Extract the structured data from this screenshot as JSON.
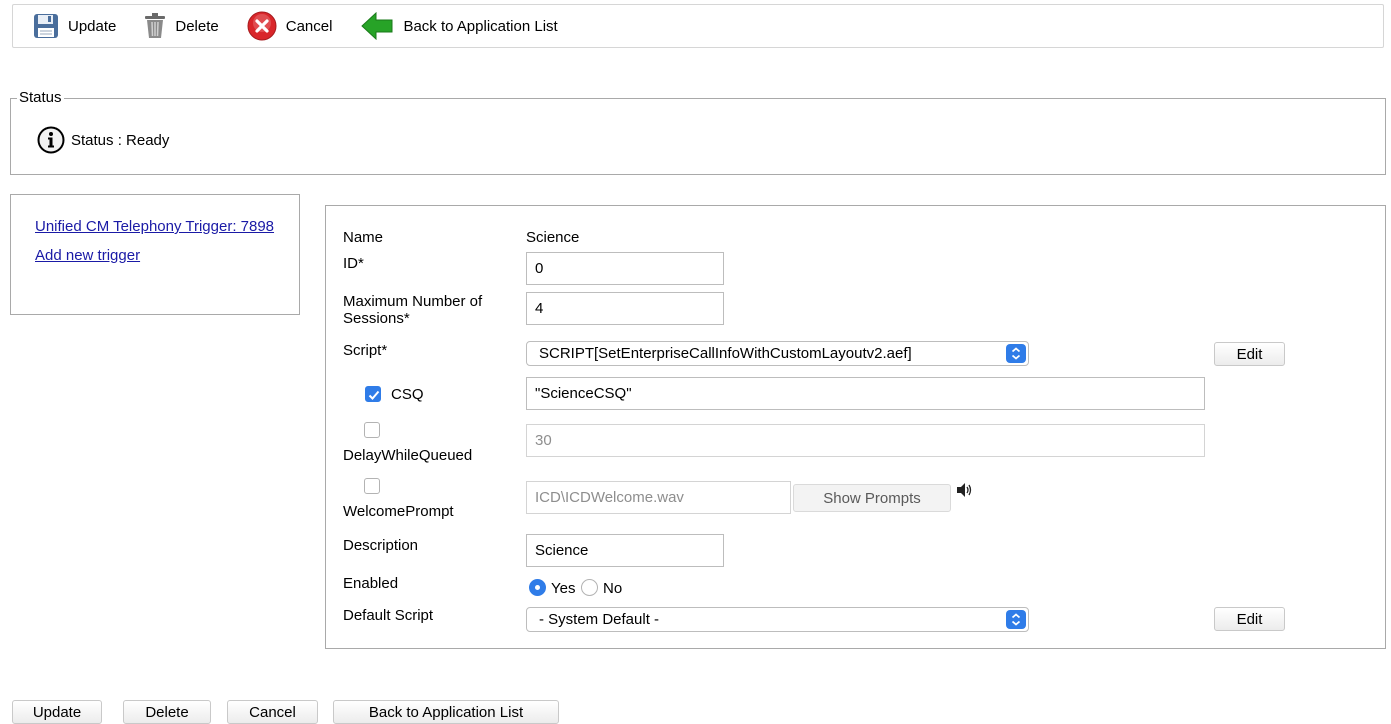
{
  "toolbar": {
    "update_label": "Update",
    "delete_label": "Delete",
    "cancel_label": "Cancel",
    "back_label": "Back to Application List"
  },
  "status": {
    "legend": "Status",
    "text": "Status : Ready"
  },
  "triggers": {
    "trigger_link": "Unified CM Telephony Trigger: 7898",
    "add_link": "Add new trigger"
  },
  "form": {
    "name_label": "Name",
    "name_value": "Science",
    "id_label": "ID*",
    "id_value": "0",
    "max_sessions_label": "Maximum Number of Sessions*",
    "max_sessions_value": "4",
    "script_label": "Script*",
    "script_value": "SCRIPT[SetEnterpriseCallInfoWithCustomLayoutv2.aef]",
    "script_edit_label": "Edit",
    "csq_label": "CSQ",
    "csq_checked": true,
    "csq_value": "\"ScienceCSQ\"",
    "delay_label": "DelayWhileQueued",
    "delay_checked": false,
    "delay_value": "30",
    "welcome_label": "WelcomePrompt",
    "welcome_checked": false,
    "welcome_value": "ICD\\ICDWelcome.wav",
    "show_prompts_label": "Show Prompts",
    "description_label": "Description",
    "description_value": "Science",
    "enabled_label": "Enabled",
    "enabled_yes_label": "Yes",
    "enabled_no_label": "No",
    "enabled_selected": "Yes",
    "default_script_label": "Default Script",
    "default_script_value": "- System Default -",
    "default_script_edit_label": "Edit"
  },
  "bottom": {
    "update_label": "Update",
    "delete_label": "Delete",
    "cancel_label": "Cancel",
    "back_label": "Back to Application List"
  },
  "colors": {
    "accent": "#2f7ce8",
    "link": "#1a1aa6",
    "cancel_red": "#d9262a",
    "back_green": "#27a327"
  },
  "icons": {
    "update": "floppy-disk-icon",
    "delete": "trash-can-icon",
    "cancel": "cancel-x-icon",
    "back": "green-left-arrow-icon",
    "status": "info-icon",
    "speaker": "speaker-icon"
  }
}
